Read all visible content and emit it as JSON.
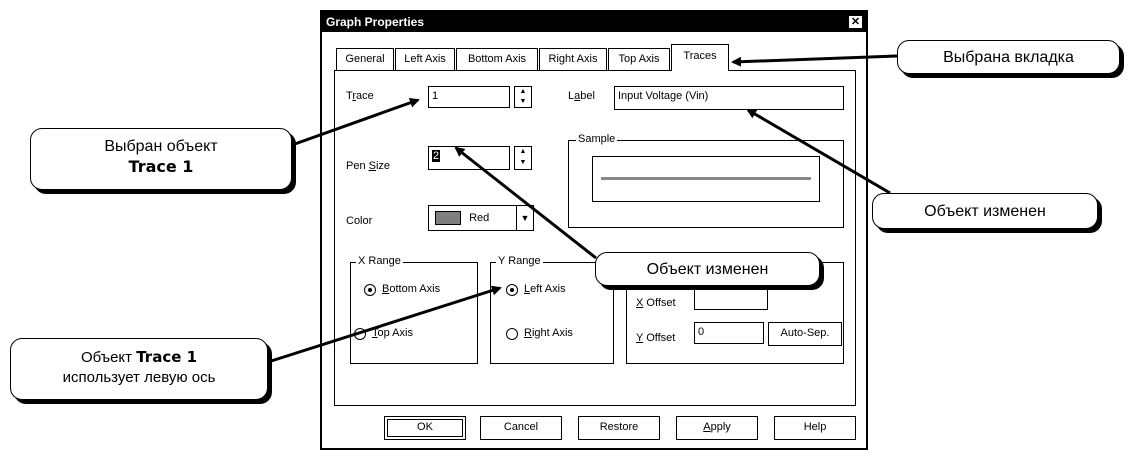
{
  "dialog": {
    "title": "Graph Properties",
    "close_glyph": "✕",
    "tabs": [
      "General",
      "Left Axis",
      "Bottom Axis",
      "Right Axis",
      "Top Axis",
      "Traces"
    ],
    "active_tab": "Traces",
    "trace": {
      "label": "Trace",
      "value": "1"
    },
    "label_field": {
      "label": "Label",
      "value": "Input Voltage (Vin)"
    },
    "pen_size": {
      "label": "Pen Size",
      "value": "2"
    },
    "sample": {
      "title": "Sample"
    },
    "color": {
      "label": "Color",
      "value": "Red",
      "swatch": "#7f7f7f"
    },
    "x_range": {
      "title": "X Range",
      "options": [
        "Bottom Axis",
        "Top Axis"
      ],
      "selected": "Bottom Axis"
    },
    "y_range": {
      "title": "Y Range",
      "options": [
        "Left Axis",
        "Right Axis"
      ],
      "selected": "Left Axis"
    },
    "x_offset": {
      "label": "X Offset"
    },
    "y_offset": {
      "label": "Y Offset",
      "value": "0",
      "button": "Auto-Sep."
    },
    "buttons": [
      "OK",
      "Cancel",
      "Restore",
      "Apply",
      "Help"
    ]
  },
  "callouts": {
    "tab_selected": "Выбрана вкладка",
    "object_selected_line1": "Выбран объект",
    "object_selected_line2": "Trace 1",
    "object_changed_1": "Объект изменен",
    "object_changed_2": "Объект изменен",
    "uses_left_axis_pre": "Объект",
    "uses_left_axis_bold": "Trace 1",
    "uses_left_axis_line2": "использует левую ось"
  }
}
